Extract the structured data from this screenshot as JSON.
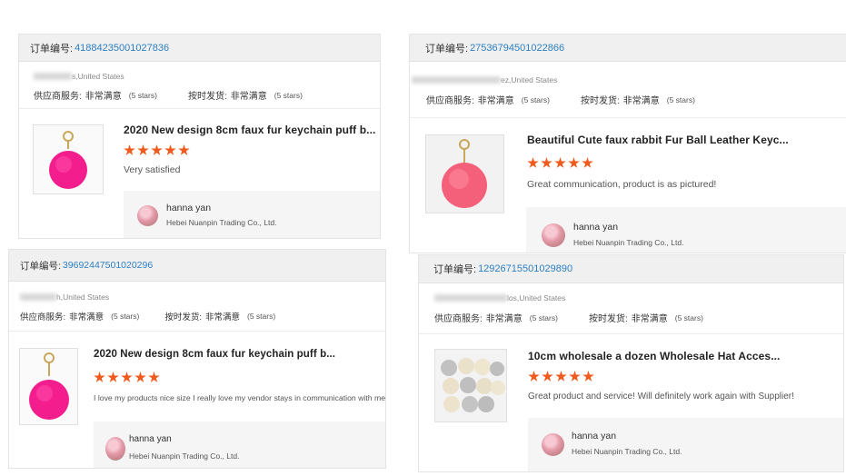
{
  "colors": {
    "accent_link": "#2c7fc3",
    "star": "#f05a1d",
    "header_bg": "#f0f0f0",
    "seller_bg": "#f5f5f5"
  },
  "labels": {
    "order_no": "订单编号:",
    "supplier_service": "供应商服务:",
    "on_time_delivery": "按时发货:",
    "rating_value": "非常满意",
    "rating_stars": "(5 stars)"
  },
  "reviews": [
    {
      "order_number": "41884235001027836",
      "buyer_location": "s,United States",
      "product_title": "2020 New design 8cm faux fur keychain puff b...",
      "product_image": "pink-pompom-keychain-image",
      "star_rating": 5,
      "comment": "Very satisfied",
      "seller_name": "hanna yan",
      "seller_company": "Hebei Nuanpin Trading Co., Ltd."
    },
    {
      "order_number": "27536794501022866",
      "buyer_location": "ez,United States",
      "product_title": "Beautiful Cute faux rabbit Fur Ball Leather Keyc...",
      "product_image": "coral-fur-ball-keychain-image",
      "star_rating": 5,
      "comment": "Great communication, product is as pictured!",
      "seller_name": "hanna yan",
      "seller_company": "Hebei Nuanpin Trading Co., Ltd."
    },
    {
      "order_number": "39692447501020296",
      "buyer_location": "h,United States",
      "product_title": "2020 New design 8cm faux fur keychain puff b...",
      "product_image": "pink-pompom-keychain-image",
      "star_rating": 5,
      "comment": "I love my products nice size I really love my vendor stays in communication with me.",
      "seller_name": "hanna yan",
      "seller_company": "Hebei Nuanpin Trading Co., Ltd."
    },
    {
      "order_number": "12926715501029890",
      "buyer_location": "los,United States",
      "product_title": "10cm wholesale a dozen Wholesale Hat Acces...",
      "product_image": "dozen-pompoms-image",
      "star_rating": 5,
      "comment": "Great product and service! Will definitely work again with Supplier!",
      "seller_name": "hanna yan",
      "seller_company": "Hebei Nuanpin Trading Co., Ltd."
    }
  ]
}
